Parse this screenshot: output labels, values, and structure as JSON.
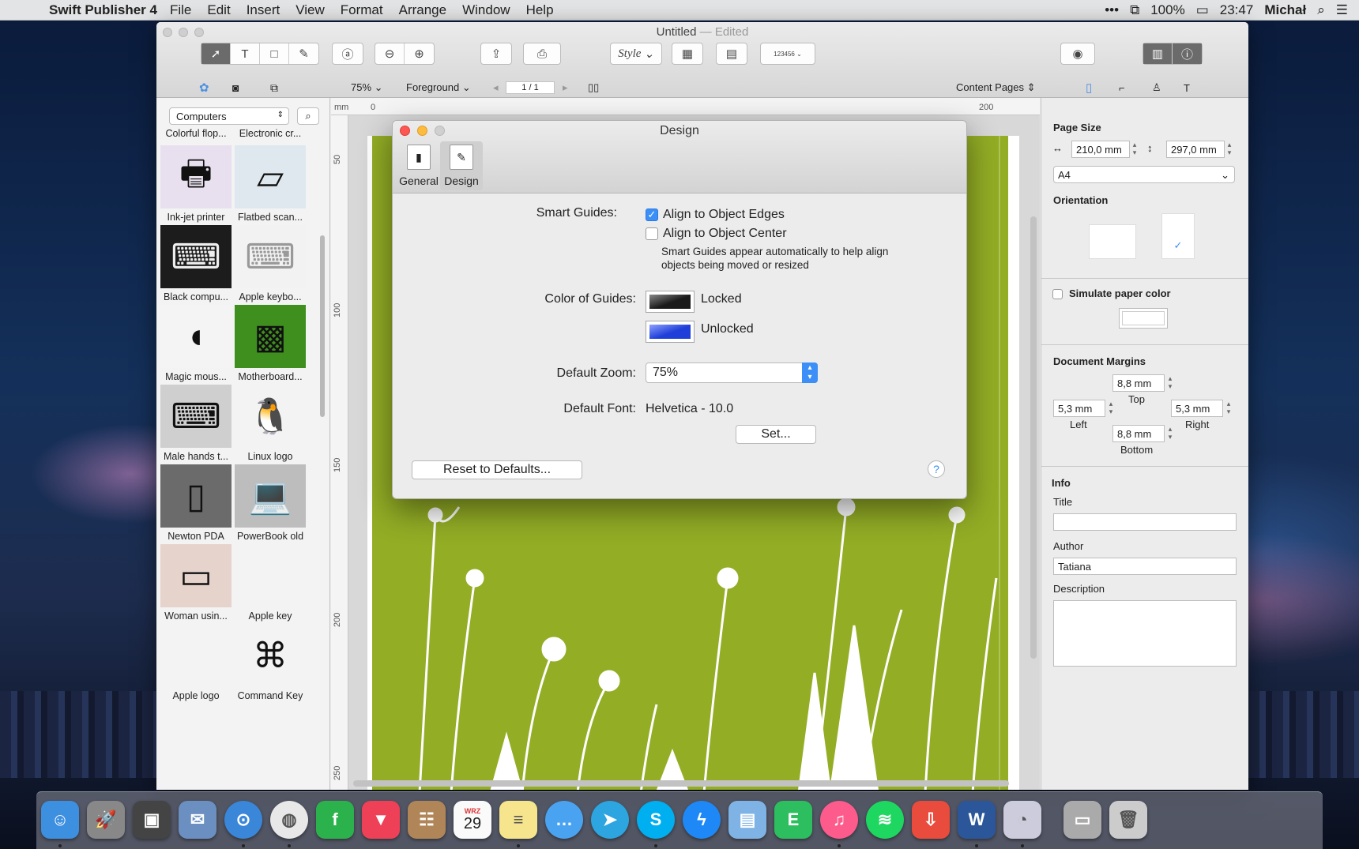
{
  "menubar": {
    "app_name": "Swift Publisher 4",
    "items": [
      "File",
      "Edit",
      "Insert",
      "View",
      "Format",
      "Arrange",
      "Window",
      "Help"
    ],
    "battery": "100%",
    "time": "23:47",
    "user": "Michał"
  },
  "window": {
    "title": "Untitled",
    "title_suffix": "— Edited"
  },
  "toolbar": {
    "style_label": "Style",
    "barcode_label": "123456"
  },
  "subbar": {
    "zoom": "75%",
    "layer": "Foreground",
    "page_indicator": "1 / 1",
    "pages_mode": "Content Pages"
  },
  "library": {
    "category": "Computers",
    "partial_top": [
      "Colorful flop...",
      "Electronic cr..."
    ],
    "items": [
      {
        "label": "Ink-jet printer",
        "icon": "printer-icon"
      },
      {
        "label": "Flatbed scan...",
        "icon": "scanner-icon"
      },
      {
        "label": "Black compu...",
        "icon": "keyboard-icon"
      },
      {
        "label": "Apple keybo...",
        "icon": "keyboard-icon"
      },
      {
        "label": "Magic mous...",
        "icon": "mouse-icon"
      },
      {
        "label": "Motherboard...",
        "icon": "circuit-icon"
      },
      {
        "label": "Male hands t...",
        "icon": "hands-keyboard-icon"
      },
      {
        "label": "Linux logo",
        "icon": "penguin-icon"
      },
      {
        "label": "Newton PDA",
        "icon": "pda-icon"
      },
      {
        "label": "PowerBook old",
        "icon": "laptop-icon"
      },
      {
        "label": "Woman usin...",
        "icon": "woman-laptop-icon"
      },
      {
        "label": "Apple key",
        "icon": "apple-outline-icon"
      },
      {
        "label": "Apple logo",
        "icon": "apple-logo-icon"
      },
      {
        "label": "Command Key",
        "icon": "command-key-icon"
      }
    ]
  },
  "rulers": {
    "unit": "mm",
    "h_ticks": [
      "0",
      "200"
    ],
    "v_ticks": [
      "50",
      "100",
      "150",
      "200",
      "250"
    ]
  },
  "dialog": {
    "title": "Design",
    "tabs": [
      {
        "label": "General",
        "icon": "switch-icon"
      },
      {
        "label": "Design",
        "icon": "pencil-icon",
        "selected": true
      }
    ],
    "smart_guides_label": "Smart Guides:",
    "align_edges": "Align to Object Edges",
    "align_edges_checked": true,
    "align_center": "Align to Object Center",
    "align_center_checked": false,
    "smart_guides_note_1": "Smart Guides appear automatically to help align",
    "smart_guides_note_2": "objects being moved or resized",
    "color_guides_label": "Color of Guides:",
    "locked_label": "Locked",
    "locked_color": "#1a1a1a",
    "unlocked_label": "Unlocked",
    "unlocked_color": "#1f3fd8",
    "default_zoom_label": "Default Zoom:",
    "default_zoom_value": "75%",
    "default_font_label": "Default Font:",
    "default_font_value": "Helvetica - 10.0",
    "set_button": "Set...",
    "reset_button": "Reset to Defaults...",
    "help_button": "?"
  },
  "inspector": {
    "page_size_title": "Page Size",
    "width": "210,0 mm",
    "height": "297,0 mm",
    "paper": "A4",
    "orientation_title": "Orientation",
    "orientation_selected": "portrait",
    "simulate_paper": "Simulate paper color",
    "margins_title": "Document Margins",
    "margin_top": "8,8 mm",
    "margin_top_label": "Top",
    "margin_left": "5,3 mm",
    "margin_left_label": "Left",
    "margin_right": "5,3 mm",
    "margin_right_label": "Right",
    "margin_bottom": "8,8 mm",
    "margin_bottom_label": "Bottom",
    "info_title": "Info",
    "title_label": "Title",
    "title_value": "",
    "author_label": "Author",
    "author_value": "Tatiana",
    "description_label": "Description",
    "description_value": ""
  },
  "dock": {
    "calendar_month": "WRZ",
    "calendar_day": "29",
    "apps": [
      "Finder",
      "Launchpad",
      "Photo Booth",
      "Mail",
      "Safari",
      "Chrome",
      "Feedly",
      "Pocket",
      "Contacts",
      "Calendar",
      "Notes",
      "Messages",
      "Telegram",
      "Skype",
      "Messenger",
      "Preview",
      "Evernote",
      "iTunes",
      "Spotify",
      "Transmit",
      "Word",
      "Swift Publisher",
      "Documents",
      "Trash"
    ]
  },
  "colors": {
    "accent": "#3b8ff6",
    "page_green": "#93ad25"
  }
}
